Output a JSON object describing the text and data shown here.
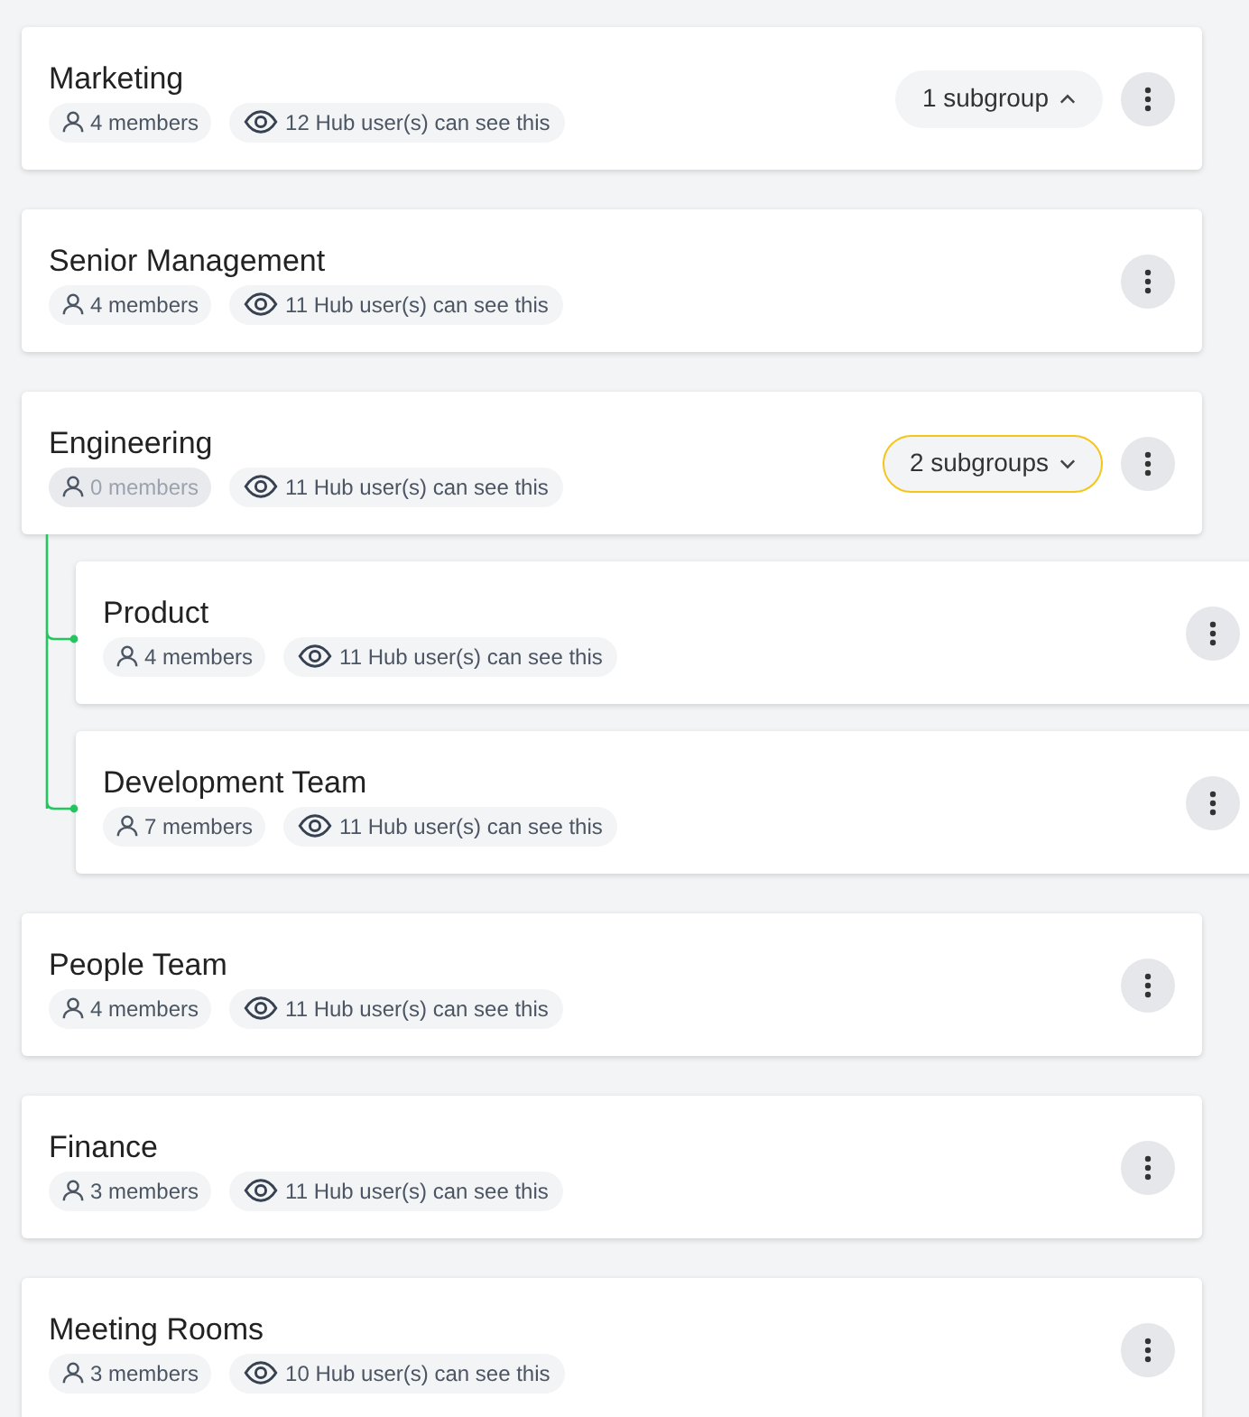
{
  "groups": [
    {
      "name": "Marketing",
      "members": "4 members",
      "members_dimmed": false,
      "visibility": "12 Hub user(s) can see this",
      "subgroups": {
        "label": "1 subgroup",
        "expanded": true,
        "focused": false
      }
    },
    {
      "name": "Senior Management",
      "members": "4 members",
      "members_dimmed": false,
      "visibility": "11 Hub user(s) can see this"
    },
    {
      "name": "Engineering",
      "members": "0 members",
      "members_dimmed": true,
      "visibility": "11 Hub user(s) can see this",
      "subgroups": {
        "label": "2 subgroups",
        "expanded": false,
        "focused": true
      },
      "children": [
        {
          "name": "Product",
          "members": "4 members",
          "members_dimmed": false,
          "visibility": "11 Hub user(s) can see this"
        },
        {
          "name": "Development Team",
          "members": "7 members",
          "members_dimmed": false,
          "visibility": "11 Hub user(s) can see this"
        }
      ]
    },
    {
      "name": "People Team",
      "members": "4 members",
      "members_dimmed": false,
      "visibility": "11 Hub user(s) can see this"
    },
    {
      "name": "Finance",
      "members": "3 members",
      "members_dimmed": false,
      "visibility": "11 Hub user(s) can see this"
    },
    {
      "name": "Meeting Rooms",
      "members": "3 members",
      "members_dimmed": false,
      "visibility": "10 Hub user(s) can see this"
    }
  ]
}
